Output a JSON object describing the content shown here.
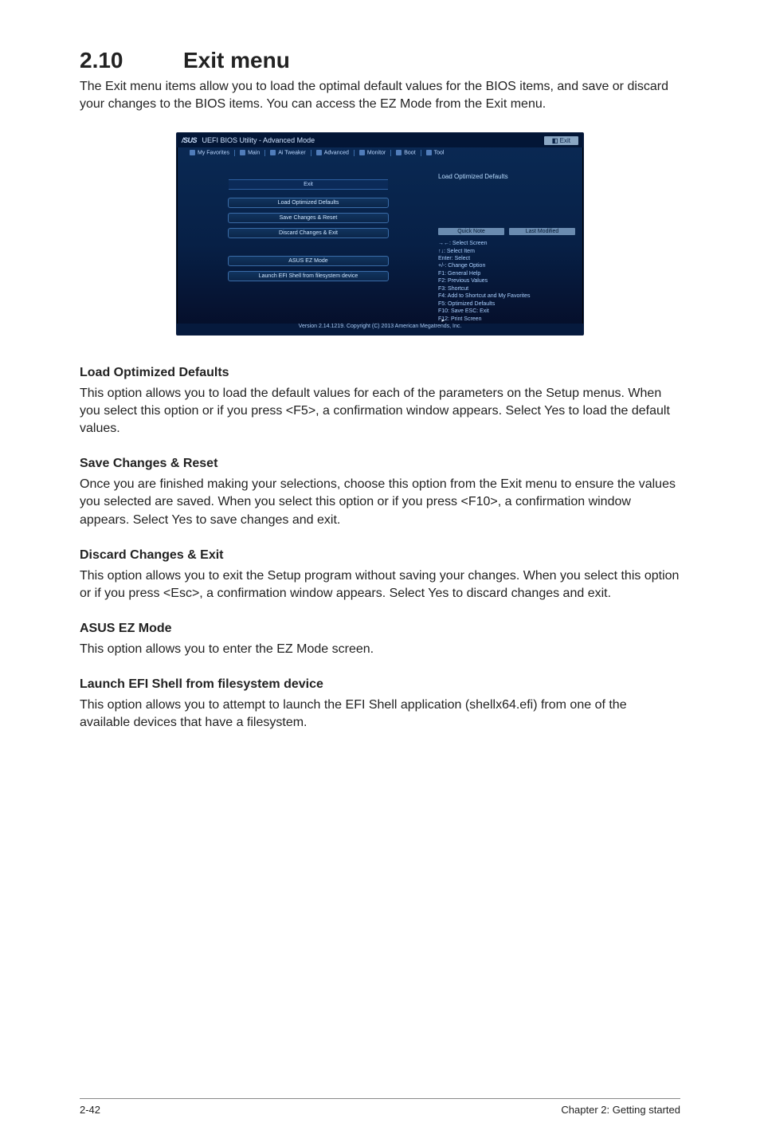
{
  "section_number": "2.10",
  "section_title": "Exit menu",
  "intro": "The Exit menu items allow you to load the optimal default values for the BIOS items, and save or discard your changes to the BIOS items. You can access the EZ Mode from the Exit menu.",
  "bios": {
    "brand": "/SUS",
    "header_title": "UEFI BIOS Utility - Advanced Mode",
    "exit_top": "Exit",
    "tabs": [
      "My Favorites",
      "Main",
      "Ai Tweaker",
      "Advanced",
      "Monitor",
      "Boot",
      "Tool"
    ],
    "left_header": "Exit",
    "buttons_top": [
      "Load Optimized Defaults",
      "Save Changes & Reset",
      "Discard Changes & Exit"
    ],
    "buttons_bottom": [
      "ASUS EZ Mode",
      "Launch EFI Shell from filesystem device"
    ],
    "help_top": "Load Optimized Defaults",
    "quick_note": "Quick Note",
    "last_modified": "Last Modified",
    "keys": "→←: Select Screen\n↑↓: Select Item\nEnter: Select\n+/-: Change Option\nF1: General Help\nF2: Previous Values\nF3: Shortcut\nF4: Add to Shortcut and My Favorites\nF5: Optimized Defaults\nF10: Save  ESC: Exit\nF12: Print Screen",
    "footer": "Version 2.14.1219. Copyright (C) 2013 American Megatrends, Inc."
  },
  "subs": [
    {
      "h": "Load Optimized Defaults",
      "p": "This option allows you to load the default values for each of the parameters on the Setup menus. When you select this option or if you press <F5>, a confirmation window appears. Select Yes to load the default values."
    },
    {
      "h": "Save Changes & Reset",
      "p": "Once you are finished making your selections, choose this option from the Exit menu to ensure the values you selected are saved. When you select this option or if you press <F10>, a confirmation window appears. Select Yes to save changes and exit."
    },
    {
      "h": "Discard Changes & Exit",
      "p": "This option allows you to exit the Setup program without saving your changes. When you select this option or if you press <Esc>, a confirmation window appears. Select Yes to discard changes and exit."
    },
    {
      "h": "ASUS EZ Mode",
      "p": "This option allows you to enter the EZ Mode screen."
    },
    {
      "h": "Launch EFI Shell from filesystem device",
      "p": "This option allows you to attempt to launch the EFI Shell application (shellx64.efi) from one of the available devices that have a filesystem."
    }
  ],
  "footer_left": "2-42",
  "footer_right": "Chapter 2: Getting started"
}
